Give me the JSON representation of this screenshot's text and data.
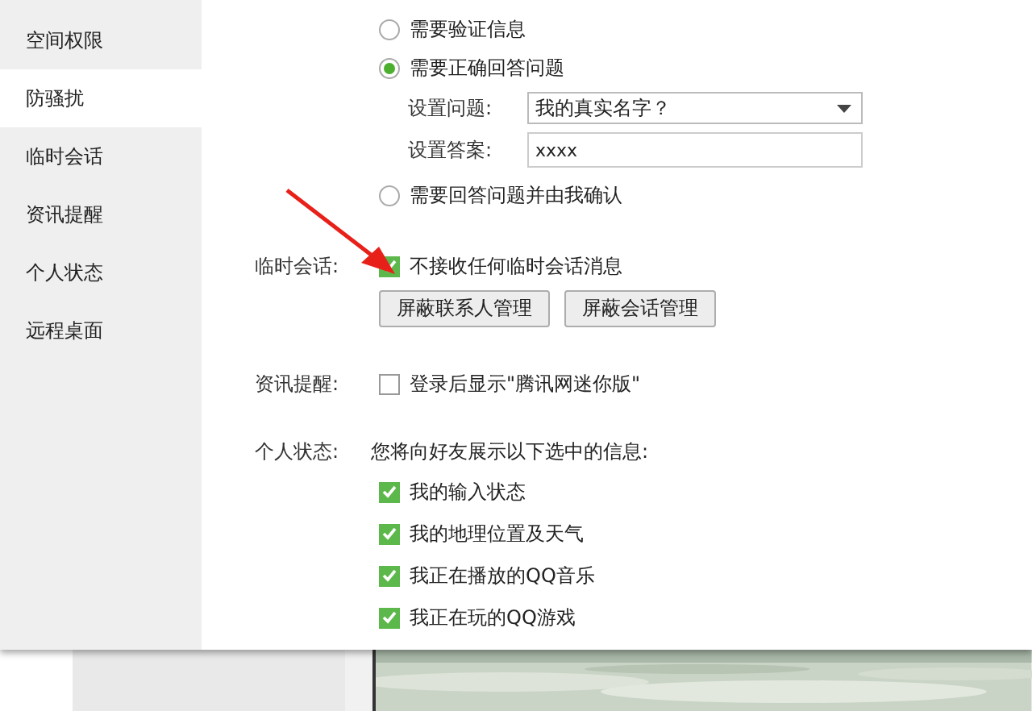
{
  "sidebar": {
    "items": [
      {
        "label": "空间权限",
        "selected": false
      },
      {
        "label": "防骚扰",
        "selected": true
      },
      {
        "label": "临时会话",
        "selected": false
      },
      {
        "label": "资讯提醒",
        "selected": false
      },
      {
        "label": "个人状态",
        "selected": false
      },
      {
        "label": "远程桌面",
        "selected": false
      }
    ]
  },
  "verification": {
    "options": [
      {
        "label": "需要验证信息",
        "selected": false
      },
      {
        "label": "需要正确回答问题",
        "selected": true
      },
      {
        "label": "需要回答问题并由我确认",
        "selected": false
      }
    ],
    "question": {
      "label": "设置问题:",
      "value": "我的真实名字？"
    },
    "answer": {
      "label": "设置答案:",
      "value": "xxxx"
    }
  },
  "temp_chat": {
    "label": "临时会话:",
    "checkbox": {
      "label": "不接收任何临时会话消息",
      "checked": true
    },
    "buttons": [
      "屏蔽联系人管理",
      "屏蔽会话管理"
    ]
  },
  "news": {
    "label": "资讯提醒:",
    "checkbox": {
      "label": "登录后显示\"腾讯网迷你版\"",
      "checked": false
    }
  },
  "status": {
    "label": "个人状态:",
    "intro": "您将向好友展示以下选中的信息:",
    "items": [
      {
        "label": "我的输入状态",
        "checked": true
      },
      {
        "label": "我的地理位置及天气",
        "checked": true
      },
      {
        "label": "我正在播放的QQ音乐",
        "checked": true
      },
      {
        "label": "我正在玩的QQ游戏",
        "checked": true
      }
    ]
  }
}
